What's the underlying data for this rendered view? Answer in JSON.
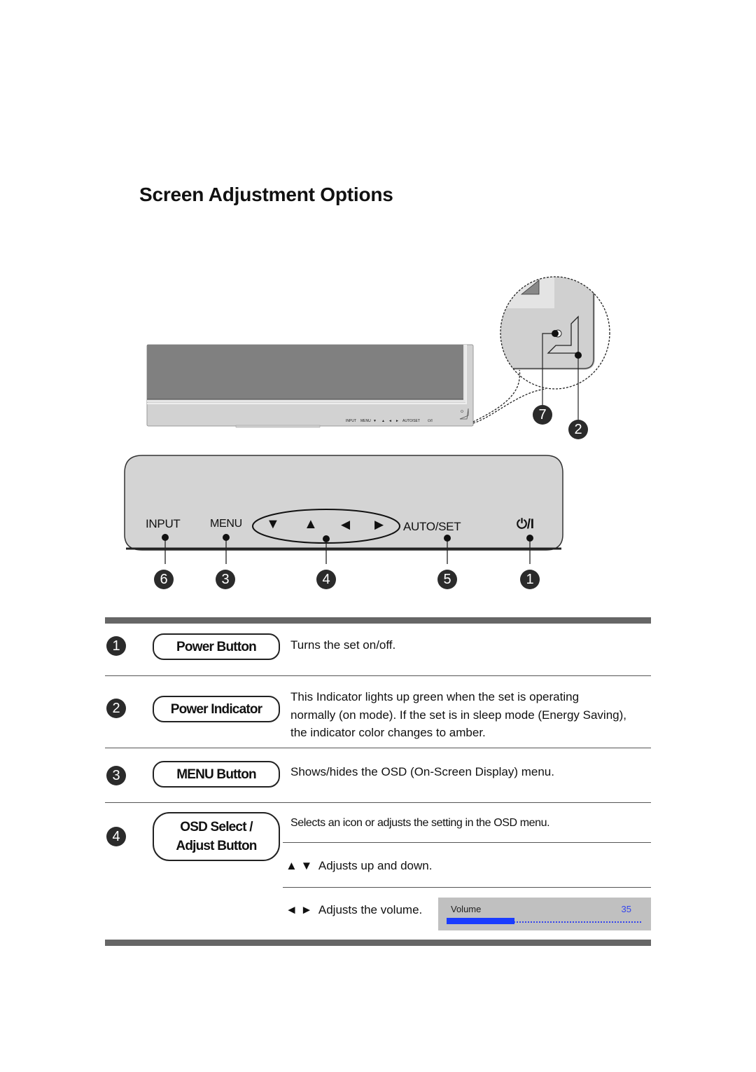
{
  "page": {
    "title": "Screen Adjustment Options"
  },
  "colors": {
    "osd_accent": "#1a3cff",
    "header_bar": "#666666",
    "panel_gray": "#d4d4d4",
    "screen_gray": "#808080"
  },
  "diagram": {
    "monitor_labels": [
      "INPUT",
      "MENU",
      "▼",
      "▲",
      "◄",
      "►",
      "AUTO/SET",
      "⏻/I"
    ],
    "panel": {
      "input_label": "INPUT",
      "menu_label": "MENU",
      "arrow_down": "▼",
      "arrow_up": "▲",
      "arrow_left": "◀",
      "arrow_right": "▶",
      "auto_set_label": "AUTO/SET",
      "power_label": "⏻/I"
    },
    "callouts": {
      "power_button": "1",
      "power_indicator": "2",
      "menu": "3",
      "osd_select": "4",
      "auto_set": "5",
      "input": "6",
      "sensor": "7"
    }
  },
  "items": [
    {
      "num": "1",
      "name": "Power Button",
      "desc": "Turns the set on/off."
    },
    {
      "num": "2",
      "name": "Power Indicator",
      "desc": "This Indicator lights up green when the set is operating normally (on mode). If the set is in sleep mode (Energy Saving), the indicator color changes to amber."
    },
    {
      "num": "3",
      "name": "MENU Button",
      "desc": "Shows/hides the OSD (On-Screen Display) menu."
    },
    {
      "num": "4",
      "name_line1": "OSD Select /",
      "name_line2": "Adjust Button",
      "desc": "Selects an icon or adjusts the setting in the OSD menu.",
      "sub": [
        {
          "symbols": "▲ ▼",
          "text": "Adjusts up and down."
        },
        {
          "symbols": "◄ ►",
          "text": "Adjusts the volume."
        }
      ]
    }
  ],
  "osd": {
    "label": "Volume",
    "value": "35",
    "fill_percent": 35
  }
}
